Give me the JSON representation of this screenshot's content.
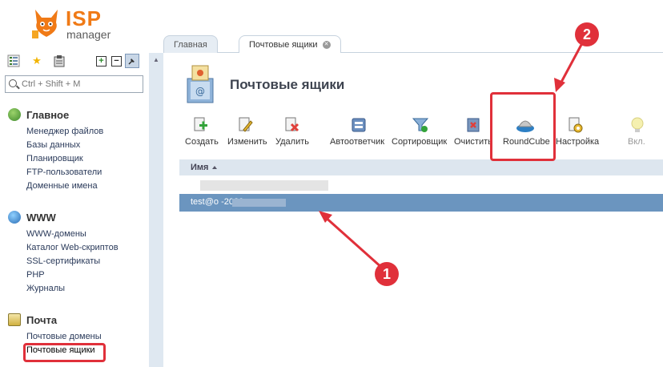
{
  "app": {
    "logo_text": "ISP",
    "logo_subtext": "manager"
  },
  "search": {
    "placeholder": "Ctrl + Shift + M"
  },
  "sidebar": {
    "sections": [
      {
        "title": "Главное",
        "items": [
          "Менеджер файлов",
          "Базы данных",
          "Планировщик",
          "FTP-пользователи",
          "Доменные имена"
        ]
      },
      {
        "title": "WWW",
        "items": [
          "WWW-домены",
          "Каталог Web-скриптов",
          "SSL-сертификаты",
          "PHP",
          "Журналы"
        ]
      },
      {
        "title": "Почта",
        "items": [
          "Почтовые домены",
          "Почтовые ящики"
        ]
      }
    ]
  },
  "tabs": [
    {
      "label": "Главная"
    },
    {
      "label": "Почтовые ящики"
    }
  ],
  "page": {
    "title": "Почтовые ящики"
  },
  "actions": [
    {
      "label": "Создать"
    },
    {
      "label": "Изменить"
    },
    {
      "label": "Удалить"
    },
    {
      "label": "Автоответчик"
    },
    {
      "label": "Сортировщик"
    },
    {
      "label": "Очистить"
    },
    {
      "label": "RoundCube"
    },
    {
      "label": "Настройка"
    },
    {
      "label": "Вкл."
    }
  ],
  "grid": {
    "column_name": "Имя",
    "selected_row": "test@o                    -2020.ru"
  },
  "callouts": [
    "1",
    "2"
  ],
  "colors": {
    "accent": "#e0303a",
    "selected_row": "#6b95bf",
    "brand": "#f07a16"
  }
}
